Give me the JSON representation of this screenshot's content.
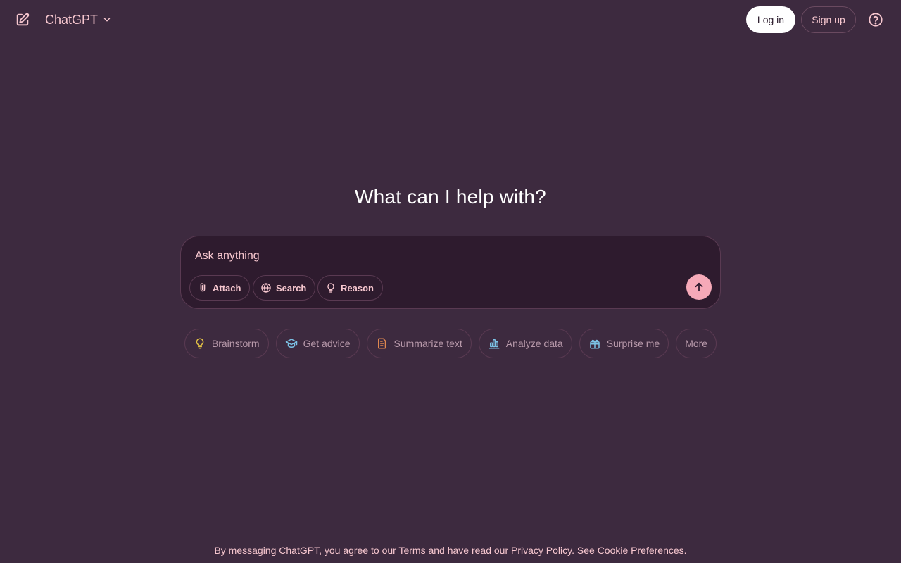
{
  "header": {
    "model_name": "ChatGPT",
    "login_label": "Log in",
    "signup_label": "Sign up",
    "icons": {
      "new_chat": "new-chat-icon",
      "model_chevron": "chevron-down-icon",
      "help": "help-circle-icon"
    }
  },
  "main": {
    "headline": "What can I help with?"
  },
  "composer": {
    "placeholder": "Ask anything",
    "value": "",
    "tools": [
      {
        "label": "Attach",
        "icon": "paperclip-icon"
      },
      {
        "label": "Search",
        "icon": "globe-icon"
      },
      {
        "label": "Reason",
        "icon": "lightbulb-icon"
      }
    ],
    "send_icon": "arrow-up-icon"
  },
  "suggestions": [
    {
      "label": "Brainstorm",
      "icon": "lightbulb-icon",
      "color": "#e2c145"
    },
    {
      "label": "Get advice",
      "icon": "graduation-cap-icon",
      "color": "#7cc3e6"
    },
    {
      "label": "Summarize text",
      "icon": "document-icon",
      "color": "#e0884f"
    },
    {
      "label": "Analyze data",
      "icon": "bar-chart-icon",
      "color": "#7cc3e6"
    },
    {
      "label": "Surprise me",
      "icon": "gift-icon",
      "color": "#7cc3e6"
    },
    {
      "label": "More",
      "icon": "",
      "color": ""
    }
  ],
  "footer": {
    "text_before": "By messaging ChatGPT, you agree to our ",
    "terms_link": "Terms",
    "text_middle": " and have read our ",
    "privacy_link": "Privacy Policy",
    "text_after_privacy": ". See ",
    "cookie_link": "Cookie Preferences",
    "text_end": "."
  },
  "colors": {
    "background": "#3d2a3f",
    "accent": "#f7c7cf",
    "composer_bg": "#2e1b2e",
    "send_button": "#f6a9b8"
  }
}
